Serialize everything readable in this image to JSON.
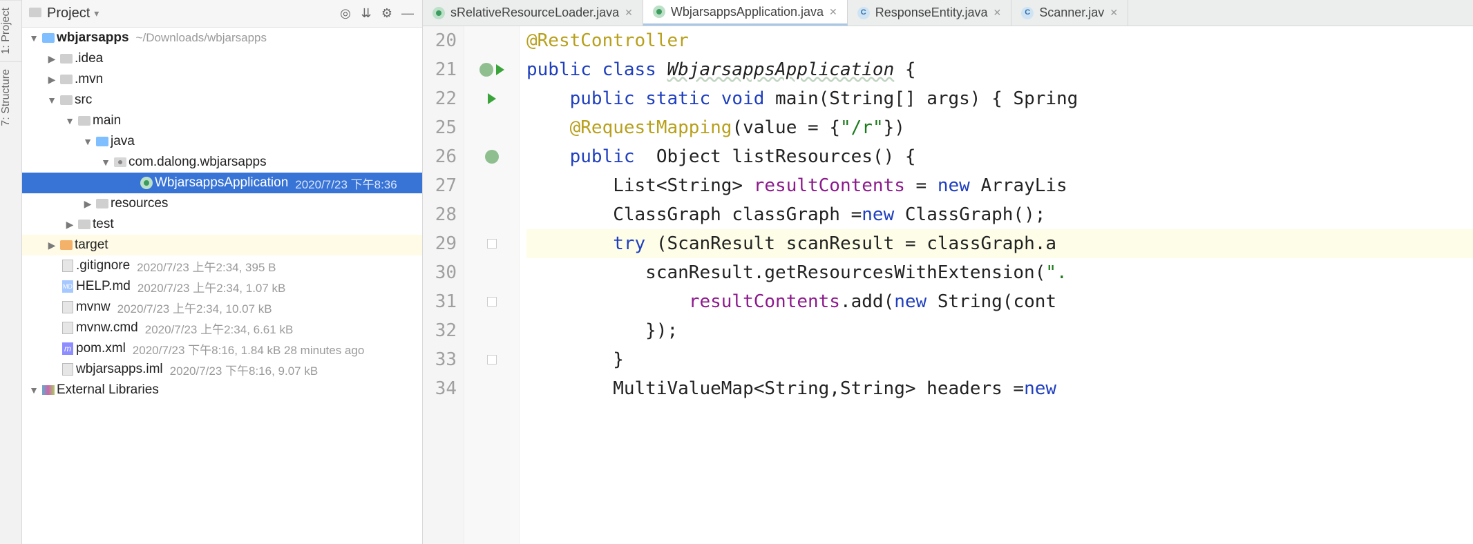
{
  "panel": {
    "title": "Project",
    "rail": {
      "project": "1: Project",
      "structure": "7: Structure"
    }
  },
  "tree": {
    "root": {
      "name": "wbjarsapps",
      "path": "~/Downloads/wbjarsapps"
    },
    "idea": ".idea",
    "mvn": ".mvn",
    "src": "src",
    "main": "main",
    "java": "java",
    "pkg": "com.dalong.wbjarsapps",
    "appclass": {
      "name": "WbjarsappsApplication",
      "meta": "2020/7/23 下午8:36"
    },
    "resources": "resources",
    "test": "test",
    "target": "target",
    "files": {
      "gitignore": {
        "name": ".gitignore",
        "meta": "2020/7/23 上午2:34, 395 B"
      },
      "help": {
        "name": "HELP.md",
        "meta": "2020/7/23 上午2:34, 1.07 kB"
      },
      "mvnw": {
        "name": "mvnw",
        "meta": "2020/7/23 上午2:34, 10.07 kB"
      },
      "mvnwcmd": {
        "name": "mvnw.cmd",
        "meta": "2020/7/23 上午2:34, 6.61 kB"
      },
      "pom": {
        "name": "pom.xml",
        "meta": "2020/7/23 下午8:16, 1.84 kB 28 minutes ago"
      },
      "iml": {
        "name": "wbjarsapps.iml",
        "meta": "2020/7/23 下午8:16, 9.07 kB"
      }
    },
    "extlib": "External Libraries"
  },
  "tabs": [
    {
      "label": "sRelativeResourceLoader.java",
      "icon": "java",
      "active": false
    },
    {
      "label": "WbjarsappsApplication.java",
      "icon": "java",
      "active": true
    },
    {
      "label": "ResponseEntity.java",
      "icon": "cls",
      "active": false
    },
    {
      "label": "Scanner.jav",
      "icon": "cls",
      "active": false
    }
  ],
  "editor": {
    "lines": [
      {
        "n": "20",
        "html": "<span class='ann'>@RestController</span>"
      },
      {
        "n": "21",
        "html": "<span class='kw'>public class</span> <span class='cls'>WbjarsappsApplication</span> {"
      },
      {
        "n": "22",
        "html": "    <span class='kw'>public static void</span> main(String[] args) { Spring"
      },
      {
        "n": "25",
        "html": "    <span class='ann'>@RequestMapping</span>(value = {<span class='str'>\"/r\"</span>})"
      },
      {
        "n": "26",
        "html": "    <span class='kw'>public</span>  Object <span class='plain'>listResources</span>() {"
      },
      {
        "n": "27",
        "html": "        List&lt;String&gt; <span class='fld'>resultContents</span> = <span class='kw'>new</span> ArrayLis"
      },
      {
        "n": "28",
        "html": "        ClassGraph classGraph =<span class='kw'>new</span> ClassGraph();"
      },
      {
        "n": "29",
        "html": "        <span class='kw'>try</span> (ScanResult scanResult = classGraph.a",
        "hl": true
      },
      {
        "n": "30",
        "html": "           scanResult.getResourcesWithExtension(<span class='str'>\".</span>"
      },
      {
        "n": "31",
        "html": "               <span class='fld'>resultContents</span>.add(<span class='kw'>new</span> String(cont"
      },
      {
        "n": "32",
        "html": "           });"
      },
      {
        "n": "33",
        "html": "        }"
      },
      {
        "n": "34",
        "html": "        MultiValueMap&lt;String,String&gt; headers =<span class='kw'>new</span> "
      }
    ],
    "gutterMarks": {
      "21": "globe-run",
      "22": "run",
      "26": "globe"
    }
  }
}
